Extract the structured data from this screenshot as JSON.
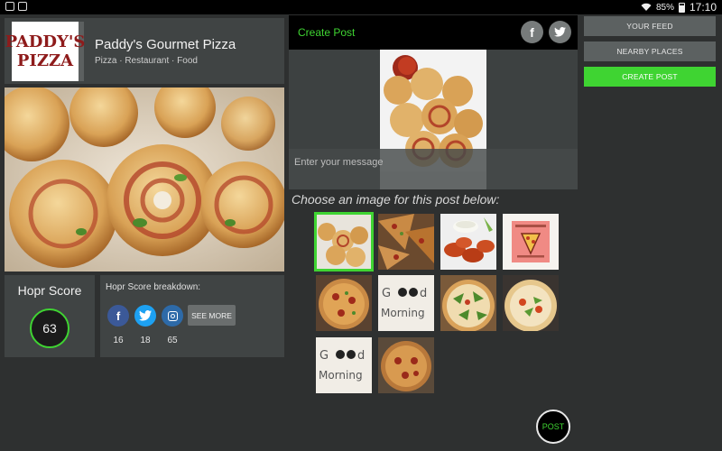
{
  "status_bar": {
    "battery": "85%",
    "time": "17:10",
    "icons": [
      "gallery-icon",
      "photo-icon",
      "wifi-icon",
      "battery-icon"
    ]
  },
  "business": {
    "logo_line1": "PADDY'S",
    "logo_line2": "PIZZA",
    "name": "Paddy's Gourmet Pizza",
    "categories": "Pizza · Restaurant · Food"
  },
  "score": {
    "title": "Hopr Score",
    "value": "63",
    "breakdown_title": "Hopr Score breakdown:",
    "see_more": "SEE MORE",
    "facebook_count": "16",
    "twitter_count": "18",
    "instagram_count": "65"
  },
  "create_post": {
    "title": "Create Post",
    "message_placeholder": "Enter your message",
    "choose_label": "Choose an image for this post below:",
    "post_button": "POST",
    "selected_thumbnail_index": 0,
    "thumbnails": [
      "pizza-rolls-photo",
      "pizza-slices-photo",
      "chicken-wings-photo",
      "pizza-logo-photo",
      "pizza-photo",
      "good-morning-photo",
      "pizza-arugula-photo",
      "pizza-greens-photo",
      "good-morning-photo",
      "pizza-pie-photo"
    ]
  },
  "nav": {
    "your_feed": "YOUR FEED",
    "nearby_places": "NEARBY PLACES",
    "create_post": "CREATE POST"
  },
  "colors": {
    "accent_green": "#3fd432",
    "background": "#2e3030",
    "card": "#404444",
    "facebook": "#3b5998",
    "twitter": "#1da1f2"
  }
}
